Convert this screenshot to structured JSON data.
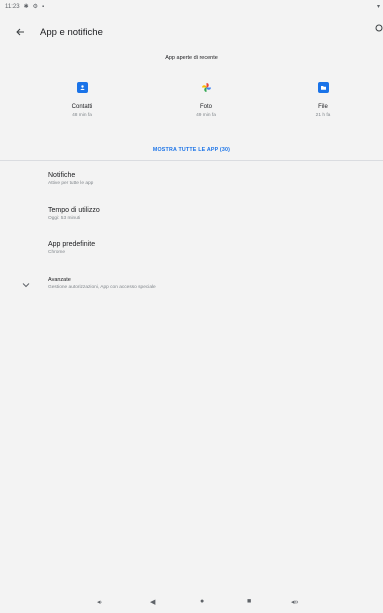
{
  "status_bar": {
    "time": "11:23",
    "icons": [
      "vibrate-icon",
      "settings-sync-icon",
      "sd-card-icon"
    ]
  },
  "toolbar": {
    "title": "App e notifiche"
  },
  "recent": {
    "header": "App aperte di recente",
    "apps": [
      {
        "name": "Contatti",
        "time": "48 min fa",
        "icon": "contacts-icon",
        "color": "#1a73e8"
      },
      {
        "name": "Foto",
        "time": "49 min fa",
        "icon": "photos-icon",
        "color": "#fbbc04"
      },
      {
        "name": "File",
        "time": "21 h fa",
        "icon": "files-icon",
        "color": "#1a73e8"
      }
    ],
    "show_all": "MOSTRA TUTTE LE APP (30)"
  },
  "settings": [
    {
      "title": "Notifiche",
      "summary": "Attive per tutte le app"
    },
    {
      "title": "Tempo di utilizzo",
      "summary": "Oggi: 53 minuti"
    },
    {
      "title": "App predefinite",
      "summary": "Chrome"
    },
    {
      "title": "Avanzate",
      "summary": "Gestione autorizzazioni, App con accesso speciale"
    }
  ],
  "nav_bar": {
    "buttons": [
      "volume-down-icon",
      "back-icon",
      "home-icon",
      "recents-icon",
      "volume-up-icon"
    ]
  },
  "colors": {
    "accent": "#1a73e8",
    "background": "#f3f3f3"
  }
}
